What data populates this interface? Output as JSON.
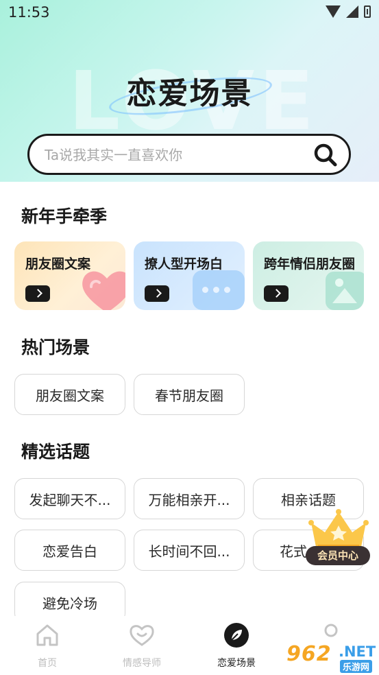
{
  "status_bar": {
    "time": "11:53"
  },
  "hero": {
    "bg_word": "LOVE",
    "title": "恋爱场景"
  },
  "search": {
    "placeholder": "Ta说我其实一直喜欢你",
    "icon": "search-icon"
  },
  "sections": {
    "new_year": {
      "title": "新年手牵季",
      "cards": [
        {
          "label": "朋友圈文案",
          "icon": "heart-icon"
        },
        {
          "label": "撩人型开场白",
          "icon": "chat-bubble-icon"
        },
        {
          "label": "跨年情侣朋友圈",
          "icon": "picture-icon"
        }
      ]
    },
    "hot": {
      "title": "热门场景",
      "chips": [
        "朋友圈文案",
        "春节朋友圈"
      ]
    },
    "topics": {
      "title": "精选话题",
      "chips": [
        "发起聊天不...",
        "万能相亲开...",
        "相亲话题",
        "恋爱告白",
        "长时间不回...",
        "花式",
        "避免冷场"
      ]
    }
  },
  "vip_badge": {
    "label": "会员中心",
    "icon": "crown-icon"
  },
  "tabbar": {
    "tabs": [
      {
        "label": "首页",
        "icon": "home-icon"
      },
      {
        "label": "情感导师",
        "icon": "heart-smile-icon"
      },
      {
        "label": "恋爱场景",
        "icon": "compass-leaf-icon",
        "active": true
      },
      {
        "label": "",
        "icon": "profile-icon"
      }
    ]
  },
  "watermark": {
    "brand": "962",
    "net": ".NET",
    "sub": "乐游网"
  },
  "colors": {
    "accent": "#1a1a1a",
    "hero_start": "#a9f1dc",
    "hero_end": "#e6eef9",
    "gold": "#fbe3b5"
  }
}
